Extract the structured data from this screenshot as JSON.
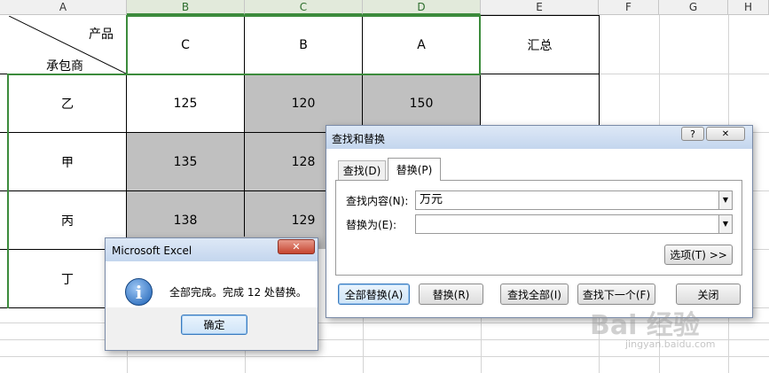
{
  "sheet": {
    "column_headers": [
      "A",
      "B",
      "C",
      "D",
      "E",
      "F",
      "G",
      "H"
    ],
    "header_cell": {
      "top_label": "产品",
      "bottom_label": "承包商"
    },
    "product_headers": [
      "C",
      "B",
      "A"
    ],
    "summary_header": "汇总",
    "rows": [
      {
        "contractor": "乙",
        "values": [
          "125",
          "120",
          "150"
        ]
      },
      {
        "contractor": "甲",
        "values": [
          "135",
          "128",
          ""
        ]
      },
      {
        "contractor": "丙",
        "values": [
          "138",
          "129",
          ""
        ]
      },
      {
        "contractor": "丁",
        "values": [
          "",
          "",
          ""
        ]
      }
    ]
  },
  "find_replace": {
    "title": "查找和替换",
    "help_button": "?",
    "close_button": "✕",
    "tabs": [
      "查找(D)",
      "替换(P)"
    ],
    "find_label": "查找内容(N):",
    "find_value": "万元",
    "replace_label": "替换为(E):",
    "replace_value": "",
    "options_button": "选项(T) >>",
    "buttons": [
      "全部替换(A)",
      "替换(R)",
      "查找全部(I)",
      "查找下一个(F)",
      "关闭"
    ]
  },
  "message_box": {
    "title": "Microsoft Excel",
    "close_button": "✕",
    "message": "全部完成。完成 12 处替换。",
    "ok_button": "确定",
    "icon": "info-icon"
  },
  "watermark": {
    "text": "Bai 经验",
    "url": "jingyan.baidu.com"
  }
}
